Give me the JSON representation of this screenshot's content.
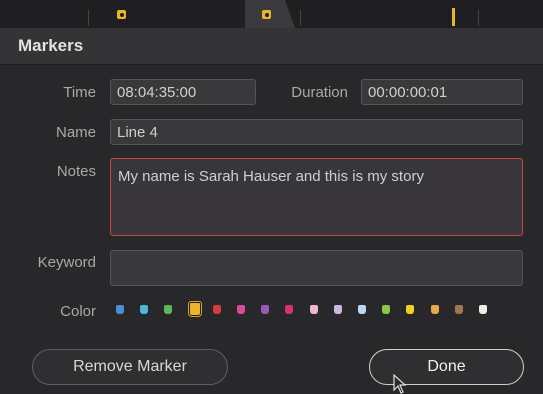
{
  "dialog": {
    "title": "Markers"
  },
  "fields": {
    "time": {
      "label": "Time",
      "value": "08:04:35:00"
    },
    "duration": {
      "label": "Duration",
      "value": "00:00:00:01"
    },
    "name": {
      "label": "Name",
      "value": "Line 4"
    },
    "notes": {
      "label": "Notes",
      "value": "My name is Sarah Hauser and this is my story"
    },
    "keyword": {
      "label": "Keyword",
      "value": ""
    }
  },
  "color": {
    "label": "Color",
    "selected_index": 3,
    "swatches": [
      "#4a8fd6",
      "#4ab8d8",
      "#5cb85c",
      "#e9b52c",
      "#d93a3a",
      "#d94a9a",
      "#9b59b6",
      "#d6336c",
      "#f0b8d0",
      "#c9b8e0",
      "#b8d8f0",
      "#8dc63f",
      "#f0d020",
      "#e8a848",
      "#a07850",
      "#f0ece4"
    ]
  },
  "buttons": {
    "remove": "Remove Marker",
    "done": "Done"
  },
  "icons": {
    "ruler_marker": "marker-icon",
    "playhead": "playhead-icon",
    "cursor": "mouse-cursor-icon"
  }
}
